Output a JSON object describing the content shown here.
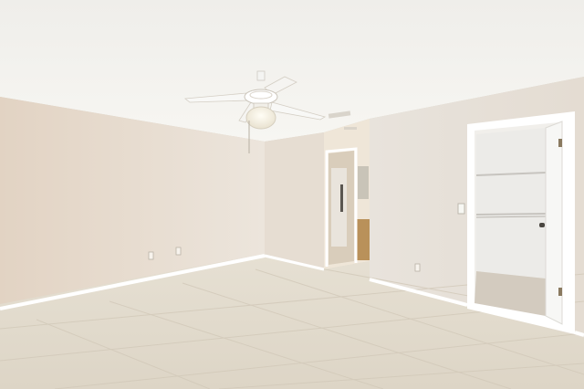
{
  "scene": {
    "description_label": "",
    "colors": {
      "ceiling": "#f1f0ec",
      "wall_left": "#e4d8cb",
      "wall_back": "#ece6dd",
      "wall_right": "#e9e4de",
      "floor": "#e3dccf",
      "trim": "#ffffff",
      "closet_interior": "#f2f1ef",
      "hallway": "#d7cdbf",
      "fan_body": "#ffffff",
      "fan_light": "#f7f3e8"
    }
  }
}
